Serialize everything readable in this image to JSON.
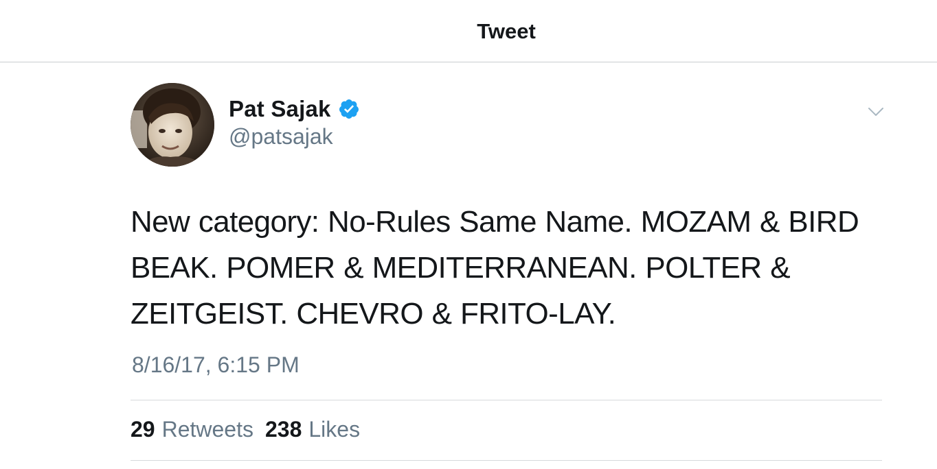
{
  "header": {
    "title": "Tweet"
  },
  "tweet": {
    "author": {
      "name": "Pat Sajak",
      "handle": "@patsajak",
      "verified": true,
      "avatar_icon": "profile-photo"
    },
    "text": "New category: No-Rules Same Name. MOZAM & BIRD BEAK. POMER & MEDITERRANEAN. POLTER & ZEITGEIST. CHEVRO & FRITO-LAY.",
    "timestamp": "8/16/17, 6:15 PM",
    "stats": {
      "retweets_count": "29",
      "retweets_label": "Retweets",
      "likes_count": "238",
      "likes_label": "Likes"
    }
  },
  "icons": {
    "verified": "verified-badge-icon",
    "menu": "chevron-down-icon"
  },
  "colors": {
    "text_primary": "#14171a",
    "text_secondary": "#657786",
    "verified_blue": "#1da1f2",
    "divider": "#d6d9dc"
  }
}
